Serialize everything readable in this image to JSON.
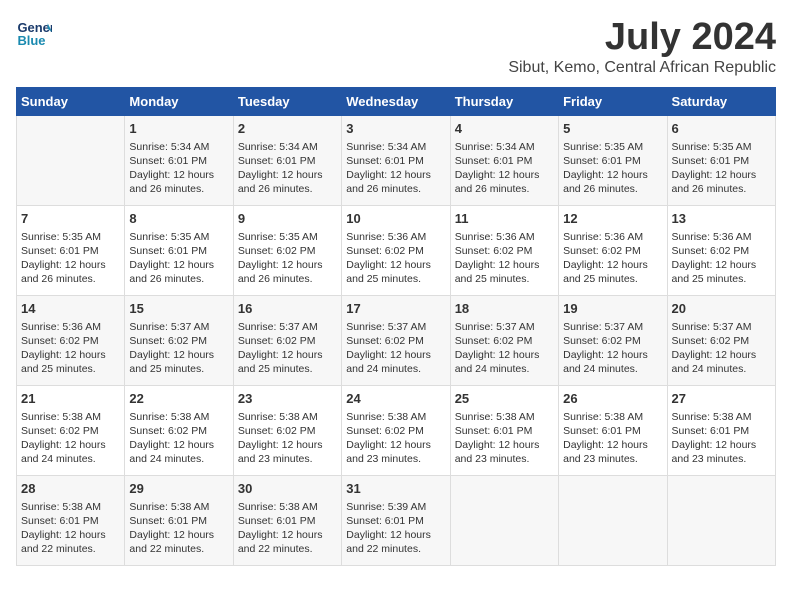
{
  "header": {
    "logo_line1": "General",
    "logo_line2": "Blue",
    "month": "July 2024",
    "location": "Sibut, Kemo, Central African Republic"
  },
  "weekdays": [
    "Sunday",
    "Monday",
    "Tuesday",
    "Wednesday",
    "Thursday",
    "Friday",
    "Saturday"
  ],
  "weeks": [
    [
      {
        "day": "",
        "content": ""
      },
      {
        "day": "1",
        "content": "Sunrise: 5:34 AM\nSunset: 6:01 PM\nDaylight: 12 hours\nand 26 minutes."
      },
      {
        "day": "2",
        "content": "Sunrise: 5:34 AM\nSunset: 6:01 PM\nDaylight: 12 hours\nand 26 minutes."
      },
      {
        "day": "3",
        "content": "Sunrise: 5:34 AM\nSunset: 6:01 PM\nDaylight: 12 hours\nand 26 minutes."
      },
      {
        "day": "4",
        "content": "Sunrise: 5:34 AM\nSunset: 6:01 PM\nDaylight: 12 hours\nand 26 minutes."
      },
      {
        "day": "5",
        "content": "Sunrise: 5:35 AM\nSunset: 6:01 PM\nDaylight: 12 hours\nand 26 minutes."
      },
      {
        "day": "6",
        "content": "Sunrise: 5:35 AM\nSunset: 6:01 PM\nDaylight: 12 hours\nand 26 minutes."
      }
    ],
    [
      {
        "day": "7",
        "content": "Sunrise: 5:35 AM\nSunset: 6:01 PM\nDaylight: 12 hours\nand 26 minutes."
      },
      {
        "day": "8",
        "content": "Sunrise: 5:35 AM\nSunset: 6:01 PM\nDaylight: 12 hours\nand 26 minutes."
      },
      {
        "day": "9",
        "content": "Sunrise: 5:35 AM\nSunset: 6:02 PM\nDaylight: 12 hours\nand 26 minutes."
      },
      {
        "day": "10",
        "content": "Sunrise: 5:36 AM\nSunset: 6:02 PM\nDaylight: 12 hours\nand 25 minutes."
      },
      {
        "day": "11",
        "content": "Sunrise: 5:36 AM\nSunset: 6:02 PM\nDaylight: 12 hours\nand 25 minutes."
      },
      {
        "day": "12",
        "content": "Sunrise: 5:36 AM\nSunset: 6:02 PM\nDaylight: 12 hours\nand 25 minutes."
      },
      {
        "day": "13",
        "content": "Sunrise: 5:36 AM\nSunset: 6:02 PM\nDaylight: 12 hours\nand 25 minutes."
      }
    ],
    [
      {
        "day": "14",
        "content": "Sunrise: 5:36 AM\nSunset: 6:02 PM\nDaylight: 12 hours\nand 25 minutes."
      },
      {
        "day": "15",
        "content": "Sunrise: 5:37 AM\nSunset: 6:02 PM\nDaylight: 12 hours\nand 25 minutes."
      },
      {
        "day": "16",
        "content": "Sunrise: 5:37 AM\nSunset: 6:02 PM\nDaylight: 12 hours\nand 25 minutes."
      },
      {
        "day": "17",
        "content": "Sunrise: 5:37 AM\nSunset: 6:02 PM\nDaylight: 12 hours\nand 24 minutes."
      },
      {
        "day": "18",
        "content": "Sunrise: 5:37 AM\nSunset: 6:02 PM\nDaylight: 12 hours\nand 24 minutes."
      },
      {
        "day": "19",
        "content": "Sunrise: 5:37 AM\nSunset: 6:02 PM\nDaylight: 12 hours\nand 24 minutes."
      },
      {
        "day": "20",
        "content": "Sunrise: 5:37 AM\nSunset: 6:02 PM\nDaylight: 12 hours\nand 24 minutes."
      }
    ],
    [
      {
        "day": "21",
        "content": "Sunrise: 5:38 AM\nSunset: 6:02 PM\nDaylight: 12 hours\nand 24 minutes."
      },
      {
        "day": "22",
        "content": "Sunrise: 5:38 AM\nSunset: 6:02 PM\nDaylight: 12 hours\nand 24 minutes."
      },
      {
        "day": "23",
        "content": "Sunrise: 5:38 AM\nSunset: 6:02 PM\nDaylight: 12 hours\nand 23 minutes."
      },
      {
        "day": "24",
        "content": "Sunrise: 5:38 AM\nSunset: 6:02 PM\nDaylight: 12 hours\nand 23 minutes."
      },
      {
        "day": "25",
        "content": "Sunrise: 5:38 AM\nSunset: 6:01 PM\nDaylight: 12 hours\nand 23 minutes."
      },
      {
        "day": "26",
        "content": "Sunrise: 5:38 AM\nSunset: 6:01 PM\nDaylight: 12 hours\nand 23 minutes."
      },
      {
        "day": "27",
        "content": "Sunrise: 5:38 AM\nSunset: 6:01 PM\nDaylight: 12 hours\nand 23 minutes."
      }
    ],
    [
      {
        "day": "28",
        "content": "Sunrise: 5:38 AM\nSunset: 6:01 PM\nDaylight: 12 hours\nand 22 minutes."
      },
      {
        "day": "29",
        "content": "Sunrise: 5:38 AM\nSunset: 6:01 PM\nDaylight: 12 hours\nand 22 minutes."
      },
      {
        "day": "30",
        "content": "Sunrise: 5:38 AM\nSunset: 6:01 PM\nDaylight: 12 hours\nand 22 minutes."
      },
      {
        "day": "31",
        "content": "Sunrise: 5:39 AM\nSunset: 6:01 PM\nDaylight: 12 hours\nand 22 minutes."
      },
      {
        "day": "",
        "content": ""
      },
      {
        "day": "",
        "content": ""
      },
      {
        "day": "",
        "content": ""
      }
    ]
  ]
}
